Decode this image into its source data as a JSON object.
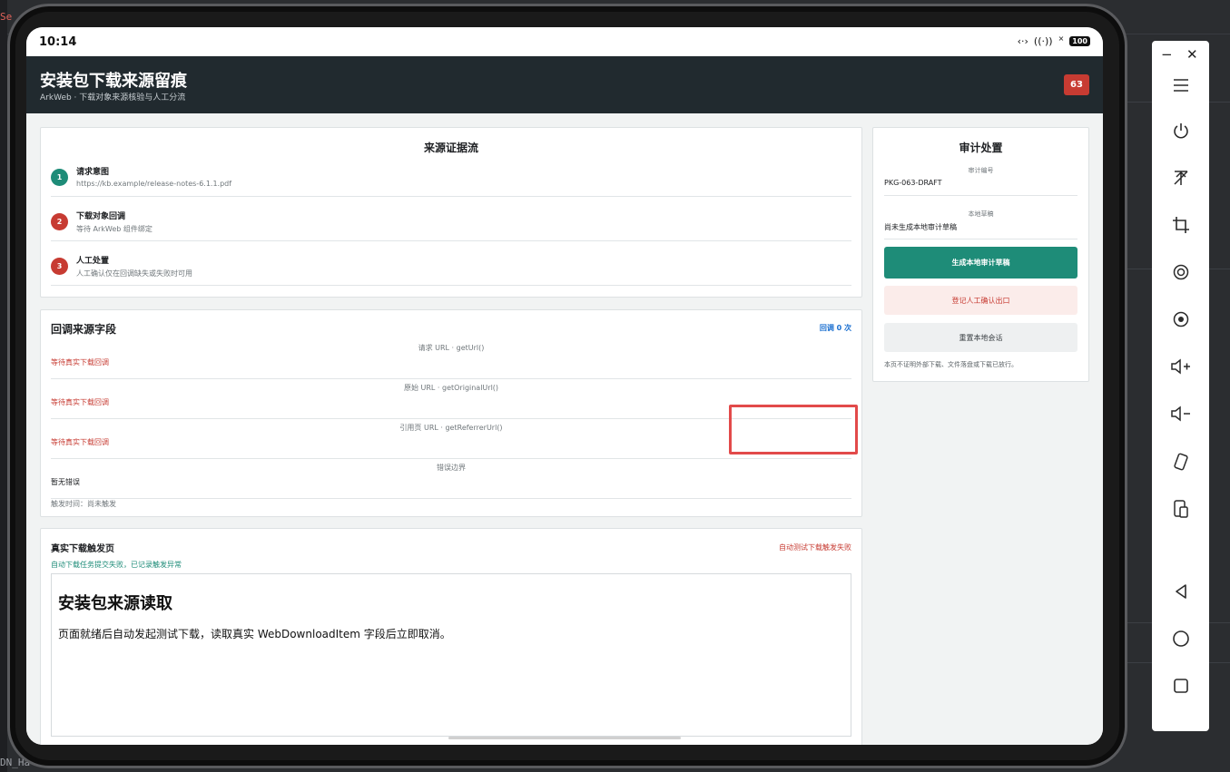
{
  "ide": {
    "side_text": "Se",
    "bottom_text": "DN_Ha"
  },
  "statusbar": {
    "time": "10:14",
    "signal": "‹·›",
    "wifi": "((·))",
    "x": "×",
    "battery": "100"
  },
  "app": {
    "title": "安装包下载来源留痕",
    "subtitle": "ArkWeb · 下载对象来源核验与人工分流",
    "badge": "63"
  },
  "evidence": {
    "title": "来源证据流",
    "steps": [
      {
        "num": "1",
        "title": "请求意图",
        "desc": "https://kb.example/release-notes-6.1.1.pdf",
        "color": "#1e8c78"
      },
      {
        "num": "2",
        "title": "下载对象回调",
        "desc": "等待 ArkWeb 组件绑定",
        "color": "#c73b32"
      },
      {
        "num": "3",
        "title": "人工处置",
        "desc": "人工确认仅在回调缺失或失败时可用",
        "color": "#c73b32"
      }
    ]
  },
  "callback": {
    "title": "回调来源字段",
    "count_link": "回调 0 次",
    "fields": [
      {
        "label": "请求 URL · getUrl()",
        "value": "等待真实下载回调"
      },
      {
        "label": "原始 URL · getOriginalUrl()",
        "value": "等待真实下载回调"
      },
      {
        "label": "引用页 URL · getReferrerUrl()",
        "value": "等待真实下载回调"
      },
      {
        "label": "错误边界",
        "value": "暂无错误"
      }
    ],
    "trigger_time": "触发时间：尚未触发"
  },
  "trigger": {
    "title": "真实下载触发页",
    "status": "自动下载任务提交失败，已记录触发异常",
    "fail": "自动测试下载触发失败",
    "frame_heading": "安装包来源读取",
    "frame_text": "页面就绪后自动发起测试下载，读取真实 WebDownloadItem 字段后立即取消。"
  },
  "audit": {
    "title": "审计处置",
    "id_label": "审计编号",
    "id_value": "PKG-063-DRAFT",
    "draft_label": "本地草稿",
    "draft_value": "尚未生成本地审计草稿",
    "btn_generate": "生成本地审计草稿",
    "btn_register": "登记人工确认出口",
    "btn_reset": "重置本地会话",
    "note": "本页不证明外部下载、文件落盘或下载已放行。"
  },
  "toolbar": {
    "minimize": "−",
    "close": "✕",
    "icons": [
      "menu-icon",
      "power-icon",
      "pin-off-icon",
      "crop-icon",
      "rotate-icon",
      "screenshot-icon",
      "volume-up-icon",
      "volume-down-icon",
      "device-rotate-icon",
      "device-icon",
      "back-icon",
      "home-icon",
      "recent-icon"
    ]
  },
  "colors": {
    "header": "#212a2f",
    "accent": "#1e8c78",
    "danger": "#c73b32",
    "link": "#1a6fd0"
  }
}
